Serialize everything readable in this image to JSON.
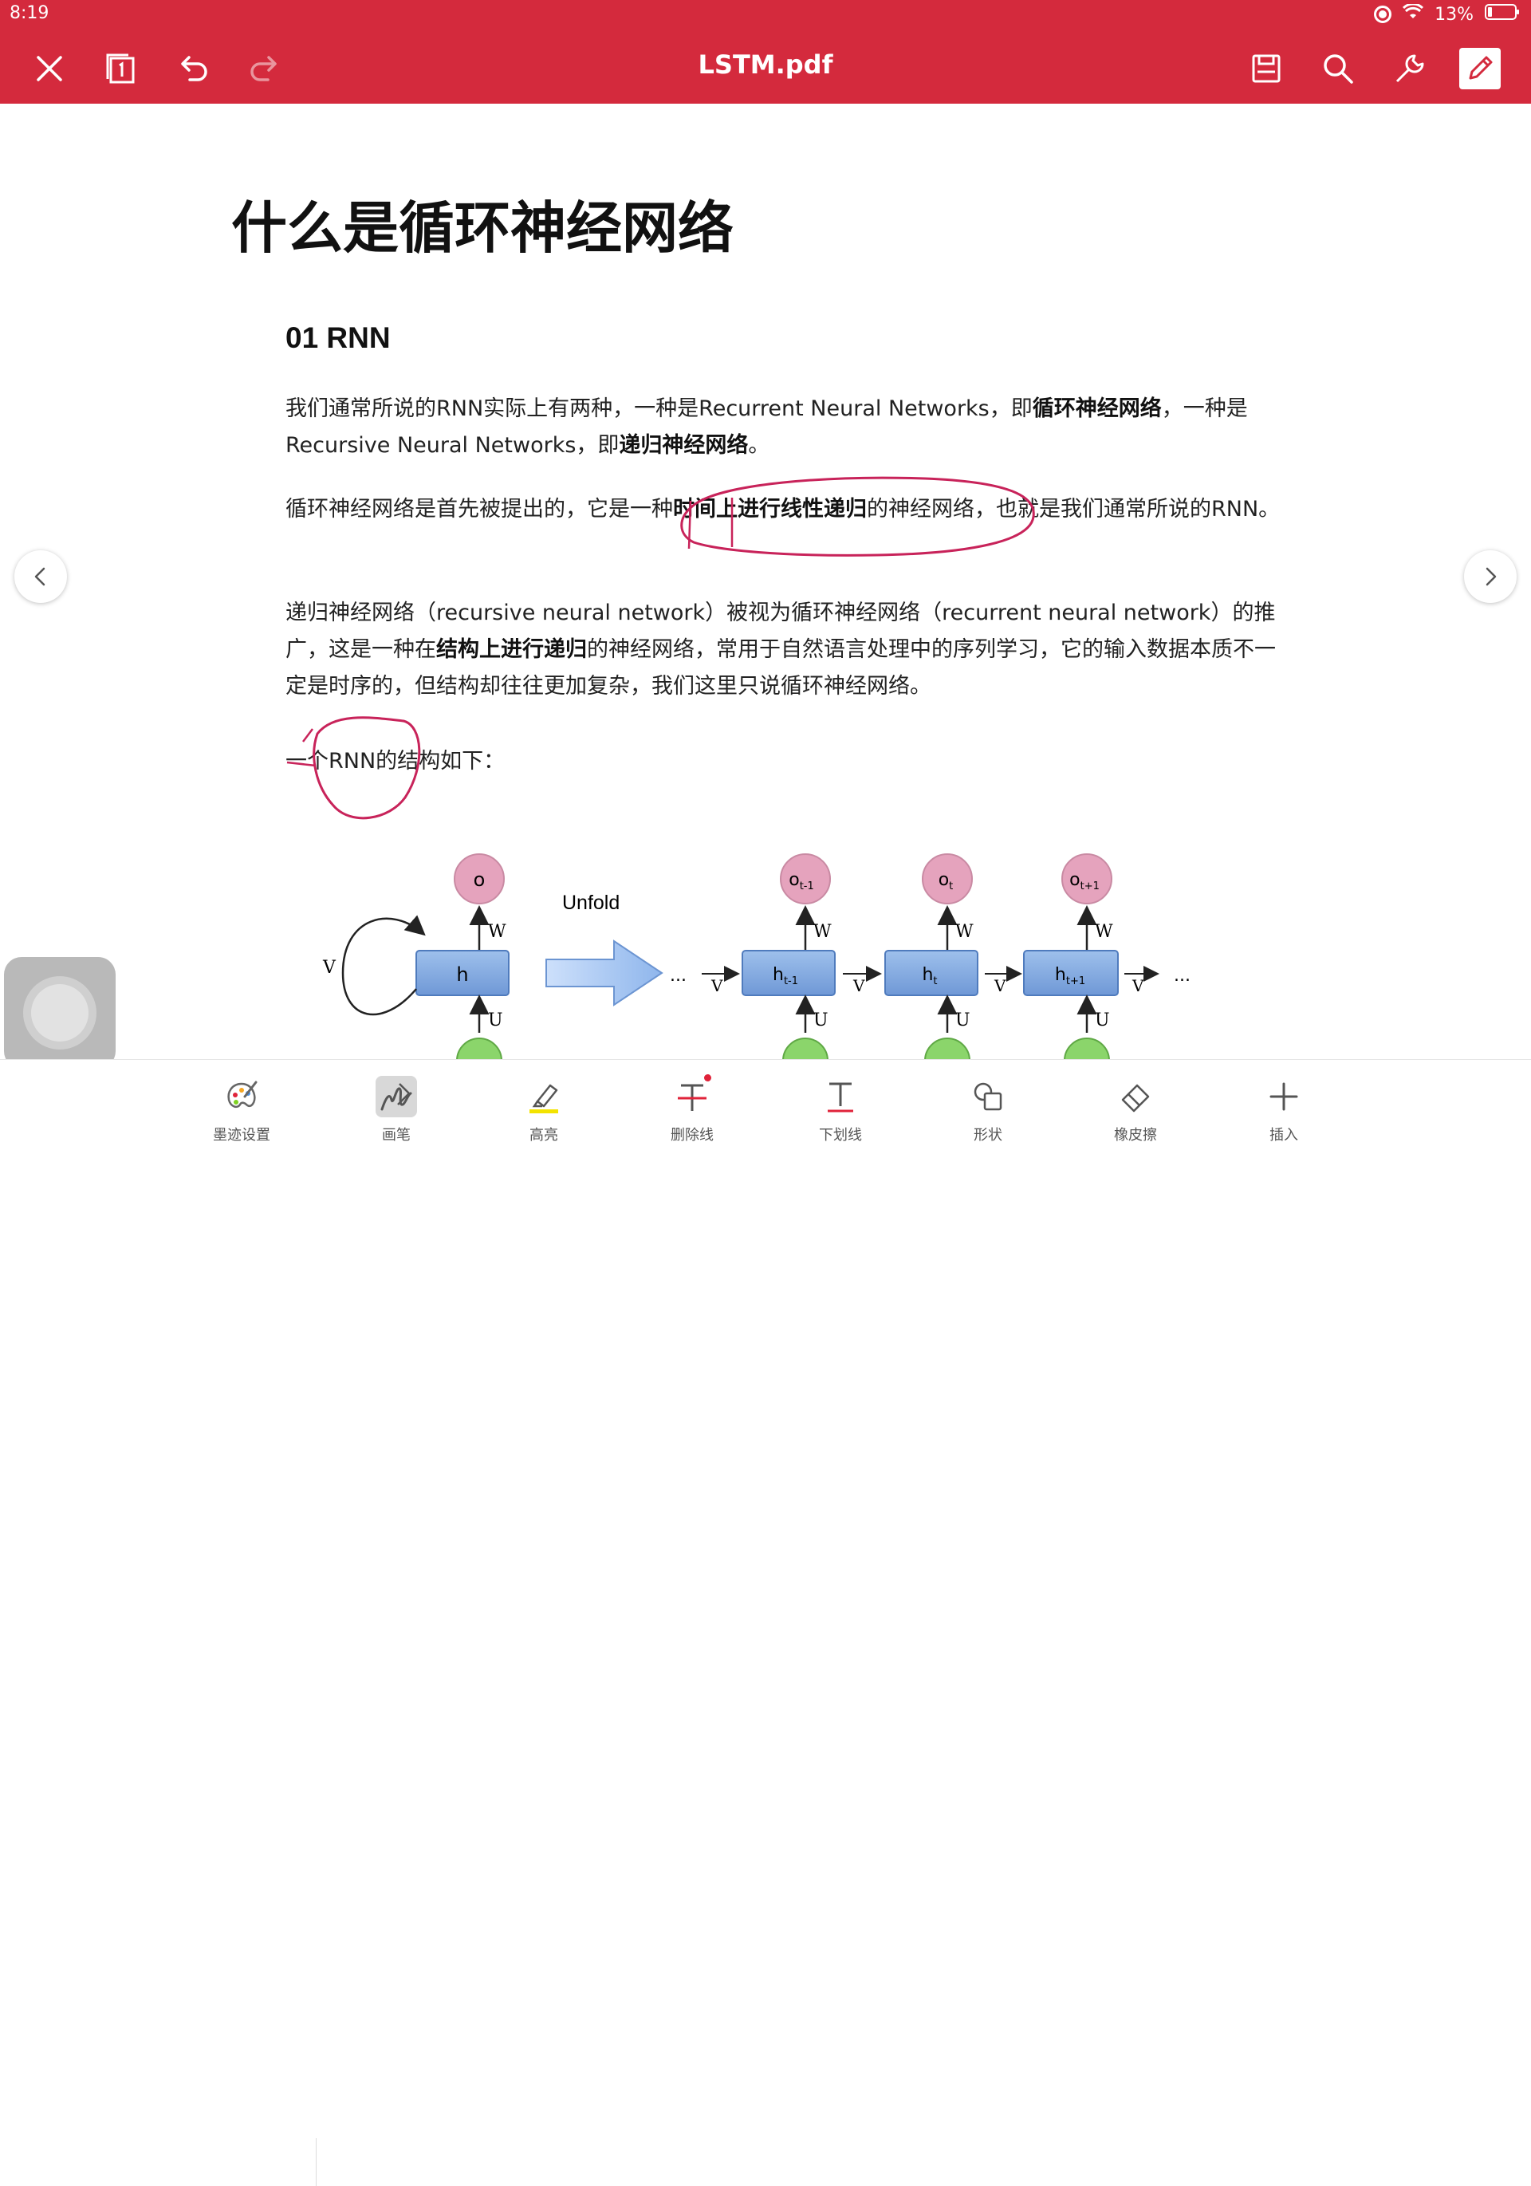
{
  "status_bar": {
    "time": "8:19",
    "battery": "13%"
  },
  "toolbar": {
    "title": "LSTM.pdf"
  },
  "document": {
    "heading": "什么是循环神经网络",
    "section": "01 RNN",
    "p1": {
      "a": "我们通常所说的RNN实际上有两种，一种是Recurrent Neural Networks，即",
      "b": "循环神经网络",
      "c": "，一种是Recursive Neural Networks，即",
      "d": "递归神经网络",
      "e": "。"
    },
    "p2": {
      "a": "循环神经网络是首先被提出的，它是一种",
      "b": "时间上进行线性递归",
      "c": "的神经网络，也就是我们通常所说的RNN。"
    },
    "p3": {
      "a": "递归神经网络（recursive neural network）被视为循环神经网络（recurrent neural network）的推广，这是一种在",
      "b": "结构上进行递归",
      "c": "的神经网络，常用于自然语言处理中的序列学习，它的输入数据本质不一定是时序的，但结构却往往更加复杂，我们这里只说循环神经网络。"
    },
    "p4": "一个RNN的结构如下："
  },
  "diagram": {
    "unfold_label": "Unfold",
    "left": {
      "out": "o",
      "hidden": "h",
      "w": "W",
      "u": "U",
      "v": "V"
    },
    "unrolled": [
      {
        "out": "o",
        "out_sub": "t-1",
        "hidden": "h",
        "hidden_sub": "t-1"
      },
      {
        "out": "o",
        "out_sub": "t",
        "hidden": "h",
        "hidden_sub": "t"
      },
      {
        "out": "o",
        "out_sub": "t+1",
        "hidden": "h",
        "hidden_sub": "t+1"
      }
    ],
    "w": "W",
    "u": "U",
    "v": "V",
    "ellipsis": "..."
  },
  "bottom_tools": [
    {
      "label": "墨迹设置",
      "icon": "palette-icon"
    },
    {
      "label": "画笔",
      "icon": "pen-icon"
    },
    {
      "label": "高亮",
      "icon": "highlighter-icon"
    },
    {
      "label": "删除线",
      "icon": "strikethrough-icon"
    },
    {
      "label": "下划线",
      "icon": "underline-icon"
    },
    {
      "label": "形状",
      "icon": "shapes-icon"
    },
    {
      "label": "橡皮擦",
      "icon": "eraser-icon"
    },
    {
      "label": "插入",
      "icon": "plus-icon"
    }
  ],
  "colors": {
    "accent": "#d42a3d",
    "ink": "#c8235a",
    "node_out": "#e5a3bd",
    "node_hidden": "#7ea6de",
    "node_in": "#8bd56b"
  }
}
